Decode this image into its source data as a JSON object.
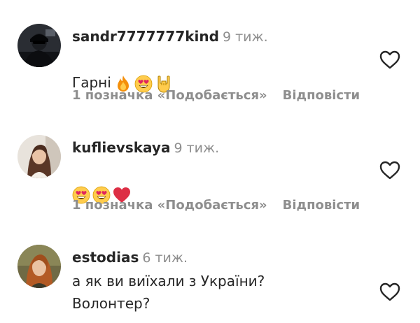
{
  "comments": [
    {
      "username": "sandr7777777kind",
      "time": "9 тиж.",
      "text": "Гарні",
      "emojis": [
        "fire-emoji",
        "heart-eyes-emoji",
        "sign-of-horns-emoji"
      ],
      "likes": "1 позначка «Подобається»",
      "reply": "Відповісти"
    },
    {
      "username": "kuflievskaya",
      "time": "9 тиж.",
      "text": "",
      "emojis": [
        "heart-eyes-emoji",
        "heart-eyes-emoji",
        "red-heart-emoji"
      ],
      "likes": "1 позначка «Подобається»",
      "reply": "Відповісти"
    },
    {
      "username": "estodias",
      "time": "6 тиж.",
      "text": "а як ви виїхали з України?\nВолонтер?",
      "emojis": []
    }
  ],
  "icons": {
    "like": "heart-outline-icon"
  },
  "colors": {
    "text": "#262626",
    "muted": "#8e8e8e",
    "background": "#ffffff"
  }
}
